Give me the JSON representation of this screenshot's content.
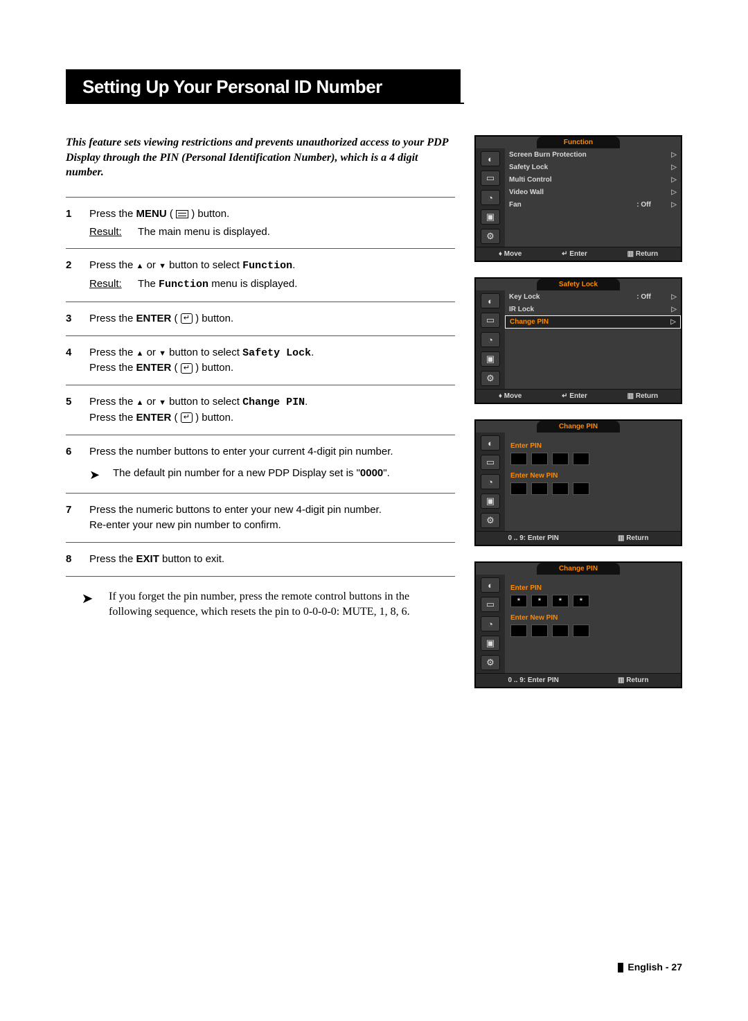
{
  "title": "Setting Up Your Personal ID Number",
  "intro": "This feature sets viewing restrictions and prevents unauthorized access to your PDP Display through the PIN (Personal Identification Number), which is a 4 digit number.",
  "steps": {
    "s1": {
      "num": "1",
      "a": "Press the ",
      "b": "MENU",
      "c": " ( ",
      "d": " ) button.",
      "result_label": "Result:",
      "result_text": "The main menu is displayed."
    },
    "s2": {
      "num": "2",
      "a": "Press the ",
      "b": " or ",
      "c": " button to select ",
      "d": "Function",
      "e": ".",
      "result_label": "Result:",
      "result_text_a": "The ",
      "result_text_b": "Function",
      "result_text_c": " menu is displayed."
    },
    "s3": {
      "num": "3",
      "a": "Press the ",
      "b": "ENTER",
      "c": " ( ",
      "d": " ) button."
    },
    "s4": {
      "num": "4",
      "a": "Press the ",
      "b": " or ",
      "c": " button to select ",
      "d": "Safety Lock",
      "e": ".",
      "f": "Press the ",
      "g": "ENTER",
      "h": " ( ",
      "i": " ) button."
    },
    "s5": {
      "num": "5",
      "a": "Press the ",
      "b": " or ",
      "c": " button to select ",
      "d": "Change PIN",
      "e": ".",
      "f": "Press the ",
      "g": "ENTER",
      "h": " ( ",
      "i": " ) button."
    },
    "s6": {
      "num": "6",
      "text": "Press the number buttons to enter your current 4-digit pin number.",
      "note_a": "The default pin number for a new PDP Display set is \"",
      "note_b": "0000",
      "note_c": "\"."
    },
    "s7": {
      "num": "7",
      "l1": "Press the numeric buttons to enter your new 4-digit pin number.",
      "l2": "Re-enter your new pin number to confirm."
    },
    "s8": {
      "num": "8",
      "a": "Press the ",
      "b": "EXIT",
      "c": " button to exit."
    }
  },
  "afternote": "If you forget the pin number, press the remote control buttons in the following sequence, which resets the pin to 0-0-0-0: MUTE, 1, 8, 6.",
  "osd1": {
    "title": "Function",
    "rows": [
      {
        "label": "Screen Burn Protection",
        "val": "",
        "arr": "▷"
      },
      {
        "label": "Safety Lock",
        "val": "",
        "arr": "▷"
      },
      {
        "label": "Multi Control",
        "val": "",
        "arr": "▷"
      },
      {
        "label": "Video Wall",
        "val": "",
        "arr": "▷"
      },
      {
        "label": "Fan",
        "val": ": Off",
        "arr": "▷"
      }
    ],
    "footer": {
      "move": "Move",
      "enter": "Enter",
      "ret": "Return"
    }
  },
  "osd2": {
    "title": "Safety Lock",
    "rows": [
      {
        "label": "Key Lock",
        "val": ": Off",
        "arr": "▷",
        "hl": false
      },
      {
        "label": "IR Lock",
        "val": "",
        "arr": "▷",
        "hl": false
      },
      {
        "label": "Change PIN",
        "val": "",
        "arr": "▷",
        "hl": true
      }
    ],
    "footer": {
      "move": "Move",
      "enter": "Enter",
      "ret": "Return"
    }
  },
  "osd3": {
    "title": "Change PIN",
    "enter_pin": "Enter PIN",
    "enter_new_pin": "Enter New PIN",
    "pin_vals": [
      "",
      "",
      "",
      ""
    ],
    "new_vals": [
      "",
      "",
      "",
      ""
    ],
    "footer": {
      "enter": "0 .. 9: Enter PIN",
      "ret": "Return"
    }
  },
  "osd4": {
    "title": "Change PIN",
    "enter_pin": "Enter PIN",
    "enter_new_pin": "Enter New PIN",
    "pin_vals": [
      "*",
      "*",
      "*",
      "*"
    ],
    "new_vals": [
      "",
      "",
      "",
      ""
    ],
    "footer": {
      "enter": "0 .. 9: Enter PIN",
      "ret": "Return"
    }
  },
  "page_footer": "English - 27"
}
